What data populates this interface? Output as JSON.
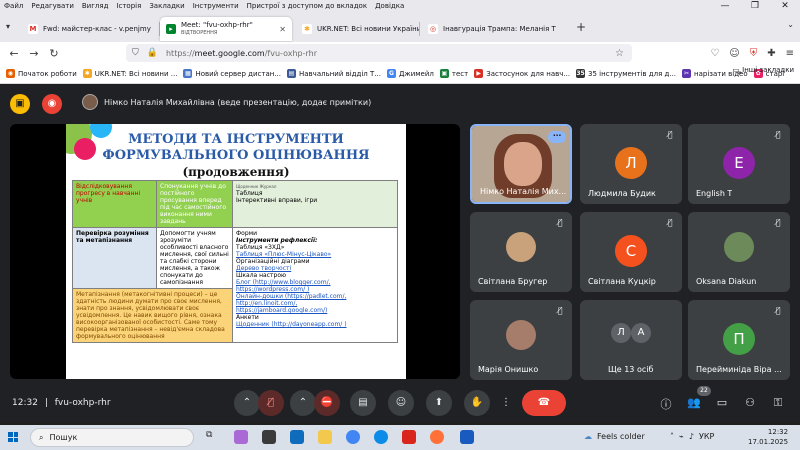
{
  "menu": [
    "Файл",
    "Редагувати",
    "Вигляд",
    "Історія",
    "Закладки",
    "Інструменти",
    "Пристрої з доступом до вкладок",
    "Довідка"
  ],
  "window_controls": [
    "—",
    "❐",
    "✕"
  ],
  "tabs": [
    {
      "title": "Fwd: майстер-клас - v.penjmy",
      "icon_color": "#d93025",
      "icon_glyph": "M"
    },
    {
      "title": "Meet: \"fvu-oxhp-rhr\"",
      "subtitle": "ВІДТВОРЕННЯ",
      "icon_color": "#00832d",
      "icon_glyph": "▸",
      "active": true
    },
    {
      "title": "UKR.NET: Всі новини України,",
      "icon_color": "#f5a623",
      "icon_glyph": "✱"
    },
    {
      "title": "Інавгурація Трампа: Меланія Т",
      "icon_color": "#d93025",
      "icon_glyph": "◎"
    }
  ],
  "url": {
    "prefix": "https://",
    "host": "meet.google.com",
    "path": "/fvu-oxhp-rhr"
  },
  "bookmarks": [
    {
      "label": "Початок роботи",
      "color": "#e66000",
      "glyph": "◉"
    },
    {
      "label": "UKR.NET: Всі новини ...",
      "color": "#f5a623",
      "glyph": "✱"
    },
    {
      "label": "Новий сервер дистан...",
      "color": "#4a76c9",
      "glyph": "▦"
    },
    {
      "label": "Навчальний відділ Т...",
      "color": "#3b5998",
      "glyph": "▤"
    },
    {
      "label": "Джимейл",
      "color": "#4285f4",
      "glyph": "G"
    },
    {
      "label": "тест",
      "color": "#188038",
      "glyph": "▣"
    },
    {
      "label": "Застосунок для навч...",
      "color": "#d93025",
      "glyph": "▶"
    },
    {
      "label": "35 інструментів для д...",
      "color": "#333333",
      "glyph": "35"
    },
    {
      "label": "нарізати відео",
      "color": "#5e35b1",
      "glyph": "✂"
    },
    {
      "label": "старі",
      "color": "#e91e63",
      "glyph": "✿"
    }
  ],
  "bookmarks_more": "»",
  "bookmarks_other": "Інші закладки",
  "presenter_banner": "Німко Наталія Михайлівна (веде презентацію, додає примітки)",
  "slide": {
    "title_line1": "МЕТОДИ ТА ІНСТРУМЕНТИ",
    "title_line2": "ФОРМУВАЛЬНОГО ОЦІНЮВАННЯ",
    "title_line3": "(продовження)",
    "rows": [
      {
        "c1": "Відслідковування прогресу в навчанні учнів",
        "c2": "Спонукання учнів до постійного просування вперед під час самостійного виконання ними завдань",
        "c3_head": "Щоденник Журнал",
        "c3": [
          "Таблиця",
          "Інтерективні вправи, ігри"
        ]
      },
      {
        "c1": "Перевірка розуміння та метапізнання",
        "c2": "Допомогти учням зрозуміти особливості власного мислення, свої сильні та слабкі сторони мислення, а також спонукати до самопізнання",
        "c3_head": "Форми",
        "c3_sub": "Інструменти рефлексії:",
        "c3": [
          "Таблиця «ЗХД»",
          "Таблиця «Плюс-Мінус-Цікаво»",
          "Організаційні діаграми",
          "Дерево творчості",
          "Шкала настрою",
          "Блог (http://www.blogger.com/,",
          "https://wordpress.com/ )",
          "Онлайн-дошки (https://padlet.com/,",
          "http://en.linoit.com/,",
          "https://jamboard.google.com/)",
          "Анкети",
          "Щоденник (http://dayoneapp.com/ )"
        ]
      },
      {
        "c1": "Метапізнання (метакогнітивні процеси) – це здатність людини думати про своє мислення, знати про знання, усвідомлювати своє усвідомлення. Це навик вищого рівня, ознака високоорганізованої особистості. Саме тому перевірка метапізнання – невід'ємна складова формувального оцінювання"
      }
    ]
  },
  "participants": [
    {
      "name": "Німко Наталія Мих...",
      "type": "video",
      "active": true
    },
    {
      "name": "Людмила Будик",
      "initial": "Л",
      "color": "#e8711c"
    },
    {
      "name": "English T",
      "initial": "E",
      "color": "#8e24aa"
    },
    {
      "name": "Світлана Бругер",
      "type": "photo",
      "color": "#c9a27c"
    },
    {
      "name": "Світлана Куцкір",
      "initial": "С",
      "color": "#f4511e"
    },
    {
      "name": "Oksana Diakun",
      "type": "photo",
      "color": "#6d8b5a"
    },
    {
      "name": "Марія Онишко",
      "type": "photo",
      "color": "#a67c6a"
    },
    {
      "name": "Ще 13 осіб",
      "type": "group",
      "initials": [
        "Л",
        "А"
      ]
    },
    {
      "name": "Перейминіда Віра ...",
      "initial": "П",
      "color": "#43a047"
    }
  ],
  "controls": {
    "time": "12:32",
    "separator": "|",
    "meeting_code": "fvu-oxhp-rhr",
    "people_count": "22"
  },
  "taskbar": {
    "search_placeholder": "Пошук",
    "weather": "Feels colder",
    "lang": "УКР",
    "time": "12:32",
    "date": "17.01.2025"
  },
  "colors": {
    "meet_bg": "#202124",
    "tile_bg": "#3c4043",
    "end_call": "#ea4335",
    "accent": "#8ab4f8"
  }
}
